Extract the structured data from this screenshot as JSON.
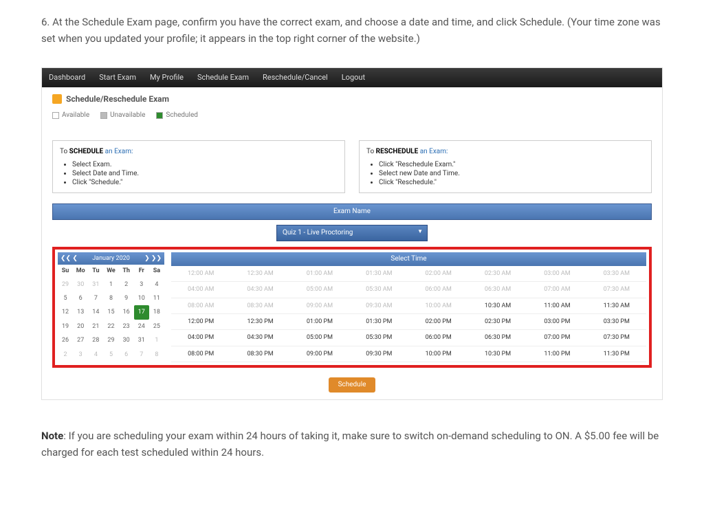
{
  "instruction": "6. At the Schedule Exam page, confirm you have the correct exam, and choose a date and time, and click Schedule. (Your time zone was set when you updated your profile; it appears in the top right corner of the website.)",
  "nav": [
    "Dashboard",
    "Start Exam",
    "My Profile",
    "Schedule Exam",
    "Reschedule/Cancel",
    "Logout"
  ],
  "panel_title": "Schedule/Reschedule Exam",
  "legend": {
    "available": "Available",
    "unavailable": "Unavailable",
    "scheduled": "Scheduled"
  },
  "schedule_box": {
    "head_prefix": "To ",
    "head_bold": "SCHEDULE",
    "head_suffix": " an Exam:",
    "items": [
      "Select Exam.",
      "Select Date and Time.",
      "Click \"Schedule.\""
    ]
  },
  "reschedule_box": {
    "head_prefix": "To ",
    "head_bold": "RESCHEDULE",
    "head_suffix": " an Exam:",
    "items": [
      "Click \"Reschedule Exam.\"",
      "Select new Date and Time.",
      "Click \"Reschedule.\""
    ]
  },
  "exam_name_label": "Exam Name",
  "dropdown_value": "Quiz 1 - Live Proctoring",
  "calendar": {
    "month": "January 2020",
    "nav_prev": "❮❮  ❮",
    "nav_next": "❯  ❯❯",
    "dow": [
      "Su",
      "Mo",
      "Tu",
      "We",
      "Th",
      "Fr",
      "Sa"
    ],
    "weeks": [
      [
        {
          "d": "29",
          "m": true
        },
        {
          "d": "30",
          "m": true
        },
        {
          "d": "31",
          "m": true
        },
        {
          "d": "1"
        },
        {
          "d": "2"
        },
        {
          "d": "3"
        },
        {
          "d": "4"
        }
      ],
      [
        {
          "d": "5"
        },
        {
          "d": "6"
        },
        {
          "d": "7"
        },
        {
          "d": "8"
        },
        {
          "d": "9"
        },
        {
          "d": "10"
        },
        {
          "d": "11"
        }
      ],
      [
        {
          "d": "12"
        },
        {
          "d": "13"
        },
        {
          "d": "14"
        },
        {
          "d": "15"
        },
        {
          "d": "16"
        },
        {
          "d": "17",
          "sel": true
        },
        {
          "d": "18"
        }
      ],
      [
        {
          "d": "19"
        },
        {
          "d": "20"
        },
        {
          "d": "21"
        },
        {
          "d": "22"
        },
        {
          "d": "23"
        },
        {
          "d": "24"
        },
        {
          "d": "25"
        }
      ],
      [
        {
          "d": "26"
        },
        {
          "d": "27"
        },
        {
          "d": "28"
        },
        {
          "d": "29"
        },
        {
          "d": "30"
        },
        {
          "d": "31"
        },
        {
          "d": "1",
          "m": true
        }
      ],
      [
        {
          "d": "2",
          "m": true
        },
        {
          "d": "3",
          "m": true
        },
        {
          "d": "4",
          "m": true
        },
        {
          "d": "5",
          "m": true
        },
        {
          "d": "6",
          "m": true
        },
        {
          "d": "7",
          "m": true
        },
        {
          "d": "8",
          "m": true
        }
      ]
    ]
  },
  "select_time_label": "Select Time",
  "time_slots": [
    {
      "t": "12:00 AM",
      "a": false
    },
    {
      "t": "12:30 AM",
      "a": false
    },
    {
      "t": "01:00 AM",
      "a": false
    },
    {
      "t": "01:30 AM",
      "a": false
    },
    {
      "t": "02:00 AM",
      "a": false
    },
    {
      "t": "02:30 AM",
      "a": false
    },
    {
      "t": "03:00 AM",
      "a": false
    },
    {
      "t": "03:30 AM",
      "a": false
    },
    {
      "t": "04:00 AM",
      "a": false
    },
    {
      "t": "04:30 AM",
      "a": false
    },
    {
      "t": "05:00 AM",
      "a": false
    },
    {
      "t": "05:30 AM",
      "a": false
    },
    {
      "t": "06:00 AM",
      "a": false
    },
    {
      "t": "06:30 AM",
      "a": false
    },
    {
      "t": "07:00 AM",
      "a": false
    },
    {
      "t": "07:30 AM",
      "a": false
    },
    {
      "t": "08:00 AM",
      "a": false
    },
    {
      "t": "08:30 AM",
      "a": false
    },
    {
      "t": "09:00 AM",
      "a": false
    },
    {
      "t": "09:30 AM",
      "a": false
    },
    {
      "t": "10:00 AM",
      "a": false
    },
    {
      "t": "10:30 AM",
      "a": true
    },
    {
      "t": "11:00 AM",
      "a": true
    },
    {
      "t": "11:30 AM",
      "a": true
    },
    {
      "t": "12:00 PM",
      "a": true
    },
    {
      "t": "12:30 PM",
      "a": true
    },
    {
      "t": "01:00 PM",
      "a": true
    },
    {
      "t": "01:30 PM",
      "a": true
    },
    {
      "t": "02:00 PM",
      "a": true
    },
    {
      "t": "02:30 PM",
      "a": true
    },
    {
      "t": "03:00 PM",
      "a": true
    },
    {
      "t": "03:30 PM",
      "a": true
    },
    {
      "t": "04:00 PM",
      "a": true
    },
    {
      "t": "04:30 PM",
      "a": true
    },
    {
      "t": "05:00 PM",
      "a": true
    },
    {
      "t": "05:30 PM",
      "a": true
    },
    {
      "t": "06:00 PM",
      "a": true
    },
    {
      "t": "06:30 PM",
      "a": true
    },
    {
      "t": "07:00 PM",
      "a": true
    },
    {
      "t": "07:30 PM",
      "a": true
    },
    {
      "t": "08:00 PM",
      "a": true
    },
    {
      "t": "08:30 PM",
      "a": true
    },
    {
      "t": "09:00 PM",
      "a": true
    },
    {
      "t": "09:30 PM",
      "a": true
    },
    {
      "t": "10:00 PM",
      "a": true
    },
    {
      "t": "10:30 PM",
      "a": true
    },
    {
      "t": "11:00 PM",
      "a": true
    },
    {
      "t": "11:30 PM",
      "a": true
    }
  ],
  "schedule_button": "Schedule",
  "note_label": "Note",
  "note_text": ": If you are scheduling your exam within 24 hours of taking it, make sure to switch on-demand scheduling to ON. A $5.00 fee will be charged for each test scheduled within 24 hours."
}
